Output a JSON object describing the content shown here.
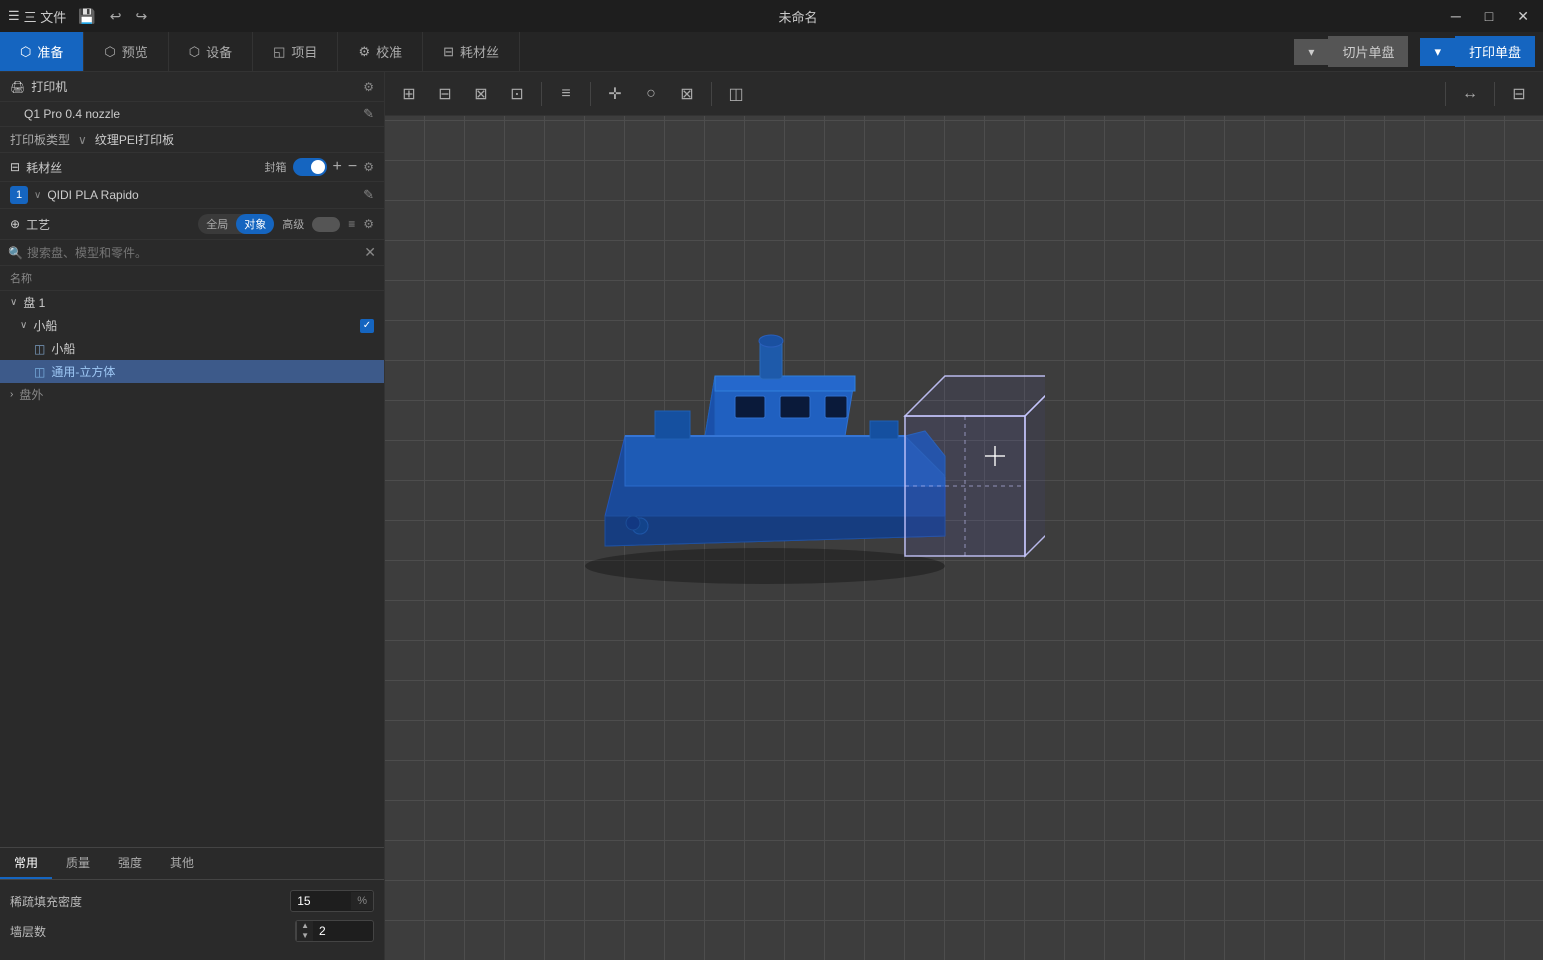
{
  "titlebar": {
    "menu_label": "三 文件",
    "title": "未命名",
    "undo_icon": "↩",
    "redo_icon": "↪",
    "win_min": "─",
    "win_max": "□",
    "win_close": "✕"
  },
  "nav": {
    "tabs": [
      {
        "id": "prepare",
        "label": "准备",
        "icon": "⬡",
        "active": true
      },
      {
        "id": "preview",
        "label": "预览",
        "icon": "⬡"
      },
      {
        "id": "device",
        "label": "设备",
        "icon": "⬡"
      },
      {
        "id": "project",
        "label": "项目",
        "icon": "⬡"
      },
      {
        "id": "calibrate",
        "label": "校准",
        "icon": "⚙"
      },
      {
        "id": "filament",
        "label": "耗材丝",
        "icon": "⬡"
      }
    ],
    "slice_single_label": "切片单盘",
    "print_single_label": "打印单盘"
  },
  "printer": {
    "section_title": "打印机",
    "nozzle_label": "Q1 Pro 0.4 nozzle",
    "plate_type_label": "打印板类型",
    "plate_value": "纹理PEI打印板"
  },
  "filament": {
    "section_title": "耗材丝",
    "box_label": "封箱",
    "items": [
      {
        "num": "1",
        "name": "QIDI PLA Rapido"
      }
    ]
  },
  "craft": {
    "section_title": "工艺",
    "modes": [
      {
        "label": "全局",
        "active": false
      },
      {
        "label": "对象",
        "active": true
      }
    ],
    "advanced_label": "高级"
  },
  "search": {
    "placeholder": "搜索盘、模型和零件。"
  },
  "tree": {
    "name_column": "名称",
    "items": [
      {
        "id": "disk1",
        "label": "盘 1",
        "level": 0,
        "type": "disk",
        "caret": "∨"
      },
      {
        "id": "small_ship",
        "label": "小船",
        "level": 1,
        "type": "group",
        "caret": "∨",
        "checked": true
      },
      {
        "id": "boat",
        "label": "小船",
        "level": 2,
        "type": "part",
        "icon": "◫"
      },
      {
        "id": "cube",
        "label": "通用-立方体",
        "level": 2,
        "type": "part",
        "icon": "◫",
        "selected": true
      },
      {
        "id": "outside",
        "label": "盘外",
        "level": 0,
        "type": "outside",
        "caret": ">"
      }
    ]
  },
  "settings": {
    "tabs": [
      {
        "label": "常用",
        "active": true
      },
      {
        "label": "质量"
      },
      {
        "label": "强度"
      },
      {
        "label": "其他"
      }
    ],
    "fields": [
      {
        "label": "稀疏填充密度",
        "value": "15",
        "unit": "%"
      },
      {
        "label": "墙层数",
        "value": "2",
        "unit": ""
      }
    ]
  },
  "viewport_tools": [
    "⊞",
    "⊟",
    "⊠",
    "⊡",
    "≡",
    "⊕",
    "○",
    "⊠",
    "⊘",
    "◫",
    "◻",
    "—",
    "◻"
  ],
  "colors": {
    "active_blue": "#1565c0",
    "bg_dark": "#2a2a2a",
    "viewport_bg": "#3d3d3d",
    "grid_line": "#4a4a4a",
    "ship_blue": "#1e5bb5",
    "ship_light": "#3d7ee8",
    "selection_box": "rgba(160,160,255,0.3)"
  }
}
